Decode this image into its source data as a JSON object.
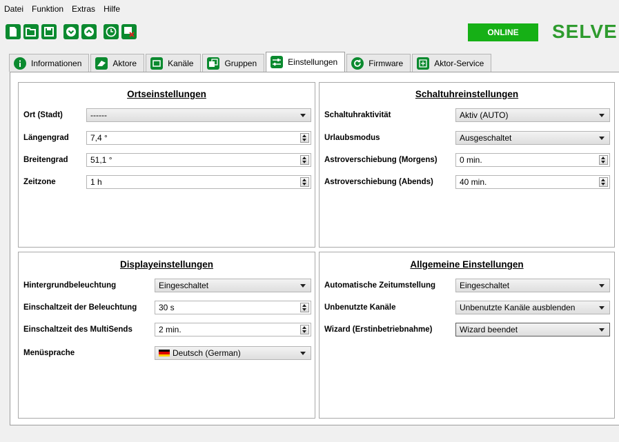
{
  "menu": [
    "Datei",
    "Funktion",
    "Extras",
    "Hilfe"
  ],
  "toolbar": {
    "icons": [
      "new-file-icon",
      "open-folder-icon",
      "save-icon",
      "down-arrow-icon",
      "up-arrow-icon",
      "clock-icon",
      "close-window-icon"
    ],
    "accent": "#0b8a2f"
  },
  "status": {
    "online_label": "ONLINE",
    "online_color": "#16b016"
  },
  "brand": {
    "text": "SELVE",
    "color": "#2e9b2e"
  },
  "tabs": [
    {
      "label": "Informationen",
      "icon": "info-icon"
    },
    {
      "label": "Aktore",
      "icon": "actuator-icon"
    },
    {
      "label": "Kanäle",
      "icon": "channels-icon"
    },
    {
      "label": "Gruppen",
      "icon": "groups-icon"
    },
    {
      "label": "Einstellungen",
      "icon": "settings-sliders-icon",
      "active": true
    },
    {
      "label": "Firmware",
      "icon": "refresh-icon"
    },
    {
      "label": "Aktor-Service",
      "icon": "service-icon"
    }
  ],
  "ort": {
    "title": "Ortseinstellungen",
    "stadt_label": "Ort (Stadt)",
    "stadt_value": "------",
    "laenge_label": "Längengrad",
    "laenge_value": "7,4 °",
    "breite_label": "Breitengrad",
    "breite_value": "51,1 °",
    "zeitzone_label": "Zeitzone",
    "zeitzone_value": "1 h"
  },
  "schaltuhr": {
    "title": "Schaltuhreinstellungen",
    "aktivitaet_label": "Schaltuhraktivität",
    "aktivitaet_value": "Aktiv (AUTO)",
    "urlaub_label": "Urlaubsmodus",
    "urlaub_value": "Ausgeschaltet",
    "morgens_label": "Astroverschiebung (Morgens)",
    "morgens_value": "0 min.",
    "abends_label": "Astroverschiebung (Abends)",
    "abends_value": "40 min."
  },
  "display": {
    "title": "Displayeinstellungen",
    "hintergrund_label": "Hintergrundbeleuchtung",
    "hintergrund_value": "Eingeschaltet",
    "einschalt_label": "Einschaltzeit der Beleuchtung",
    "einschalt_value": "30 s",
    "multisend_label": "Einschaltzeit des MultiSends",
    "multisend_value": "2 min.",
    "sprache_label": "Menüsprache",
    "sprache_value": "Deutsch (German)"
  },
  "allgemein": {
    "title": "Allgemeine Einstellungen",
    "zeitumstellung_label": "Automatische Zeitumstellung",
    "zeitumstellung_value": "Eingeschaltet",
    "kanaele_label": "Unbenutzte Kanäle",
    "kanaele_value": "Unbenutzte Kanäle ausblenden",
    "wizard_label": "Wizard (Erstinbetriebnahme)",
    "wizard_value": "Wizard beendet"
  }
}
